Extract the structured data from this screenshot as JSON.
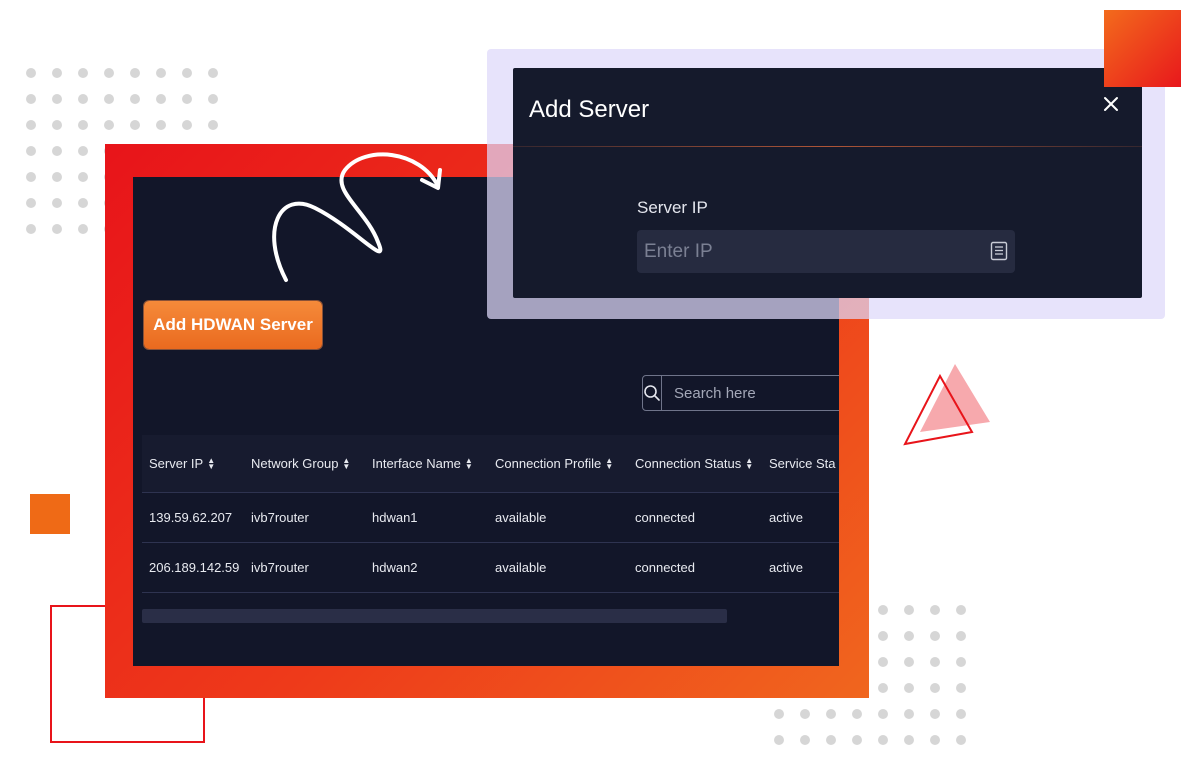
{
  "modal": {
    "title": "Add Server",
    "field_label": "Server IP",
    "field_placeholder": "Enter IP"
  },
  "add_button_label": "Add HDWAN Server",
  "search": {
    "placeholder": "Search here"
  },
  "table": {
    "columns": [
      "Server IP",
      "Network Group",
      "Interface Name",
      "Connection Profile",
      "Connection Status",
      "Service Sta"
    ],
    "rows": [
      [
        "139.59.62.207",
        "ivb7router",
        "hdwan1",
        "available",
        "connected",
        "active"
      ],
      [
        "206.189.142.59",
        "ivb7router",
        "hdwan2",
        "available",
        "connected",
        "active"
      ]
    ]
  },
  "colors": {
    "accent_orange": "#ef6a16",
    "accent_red": "#e8141a",
    "app_background": "#121629",
    "modal_background": "#151a2c"
  },
  "icons": [
    "search-icon",
    "close-icon",
    "document-list-icon",
    "sort-icon"
  ]
}
